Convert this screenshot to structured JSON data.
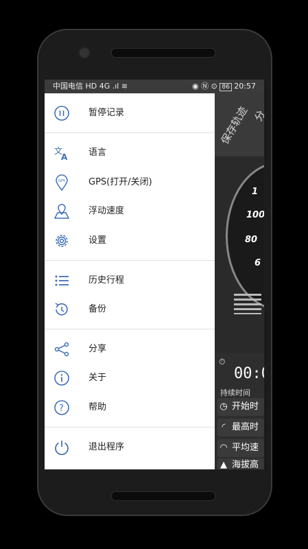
{
  "status_bar": {
    "carrier": "中国电信",
    "network": "HD 4G .ıl",
    "battery": "86",
    "time": "20:57"
  },
  "background_app": {
    "tab_label_1": "保存轨迹",
    "tab_label_2": "分",
    "speed_ticks": [
      "1",
      "100",
      "80",
      "6"
    ],
    "timer_value": "00:0",
    "duration_label": "持续时间",
    "rows": [
      {
        "icon": "clock-icon",
        "label": "开始时"
      },
      {
        "icon": "speedometer-icon",
        "label": "最高时"
      },
      {
        "icon": "avg-speed-icon",
        "label": "平均速"
      },
      {
        "icon": "mountain-icon",
        "label": "海拔高"
      }
    ]
  },
  "drawer": {
    "items": [
      {
        "icon": "pause-icon",
        "label": "暂停记录"
      },
      {
        "icon": "translate-icon",
        "label": "语言"
      },
      {
        "icon": "gps-pin-icon",
        "label": "GPS(打开/关闭)"
      },
      {
        "icon": "floating-speed-icon",
        "label": "浮动速度"
      },
      {
        "icon": "gear-icon",
        "label": "设置"
      },
      {
        "icon": "list-icon",
        "label": "历史行程"
      },
      {
        "icon": "backup-icon",
        "label": "备份"
      },
      {
        "icon": "share-icon",
        "label": "分享"
      },
      {
        "icon": "info-icon",
        "label": "关于"
      },
      {
        "icon": "help-icon",
        "label": "帮助"
      },
      {
        "icon": "power-icon",
        "label": "退出程序"
      }
    ]
  },
  "colors": {
    "accent": "#3f6fb5",
    "drawer_bg": "#ffffff",
    "status_bar": "#3b3b3b"
  }
}
